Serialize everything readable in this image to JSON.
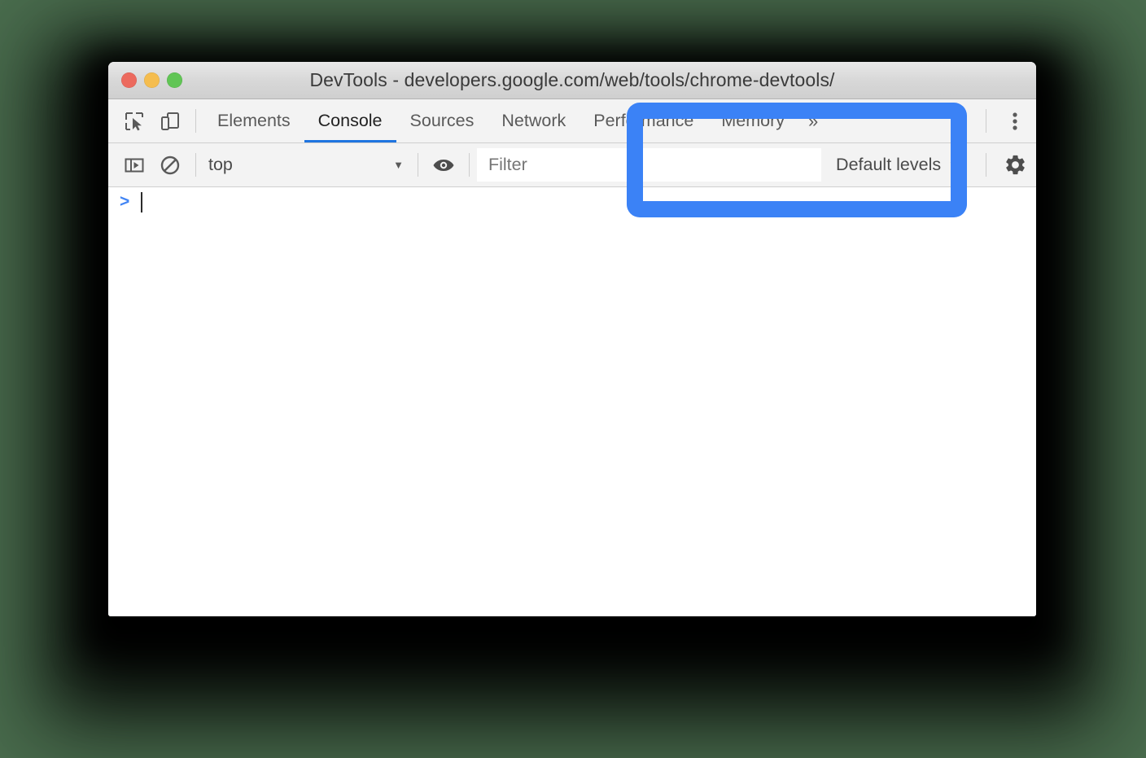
{
  "window": {
    "title": "DevTools - developers.google.com/web/tools/chrome-devtools/",
    "traffic_lights": [
      {
        "name": "close",
        "color": "#ec6a5e"
      },
      {
        "name": "minimize",
        "color": "#f5bd4f"
      },
      {
        "name": "maximize",
        "color": "#61c555"
      }
    ]
  },
  "panel_tabbar": {
    "inspect_icon": "inspect-element-icon",
    "device_icon": "device-toolbar-icon",
    "tabs": [
      {
        "label": "Elements",
        "active": false
      },
      {
        "label": "Console",
        "active": true
      },
      {
        "label": "Sources",
        "active": false
      },
      {
        "label": "Network",
        "active": false
      },
      {
        "label": "Performance",
        "active": false
      },
      {
        "label": "Memory",
        "active": false
      }
    ],
    "overflow_label": "»",
    "more_options_icon": "three-dot-menu-icon"
  },
  "console_toolbar": {
    "sidebar_toggle_icon": "console-sidebar-toggle-icon",
    "clear_console_icon": "clear-console-icon",
    "context": {
      "value": "top",
      "caret": "▼"
    },
    "live_expression_icon": "eye-icon",
    "filter": {
      "value": "",
      "placeholder": "Filter"
    },
    "levels": {
      "value": "Default levels",
      "caret": "▼"
    },
    "settings_icon": "gear-icon"
  },
  "console_body": {
    "prompt_symbol": ">",
    "input_value": ""
  },
  "annotation": {
    "name": "blue-highlight-box",
    "color": "#3b82f6",
    "shape": "rounded-rectangle-outline"
  },
  "colors": {
    "background_green": "#4a6d4e",
    "accent_blue": "#1f74e0",
    "annotation_blue": "#3b82f6",
    "prompt_blue": "#4285f4",
    "toolbar_grey": "#f3f3f3"
  }
}
